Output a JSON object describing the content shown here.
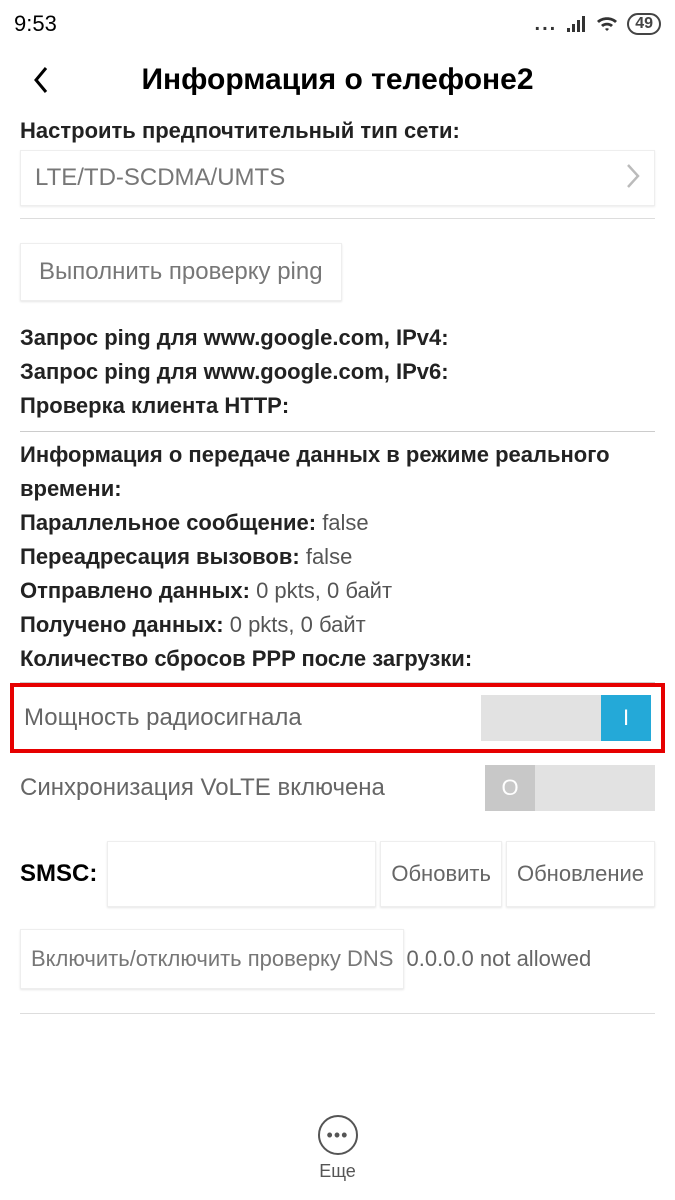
{
  "status": {
    "time": "9:53",
    "battery": "49"
  },
  "header": {
    "title": "Информация о телефоне2"
  },
  "network": {
    "label": "Настроить предпочтительный тип сети:",
    "value": "LTE/TD-SCDMA/UMTS"
  },
  "ping": {
    "button": "Выполнить проверку ping",
    "ipv4": "Запрос ping для www.google.com, IPv4:",
    "ipv6": "Запрос ping для www.google.com, IPv6:",
    "http": "Проверка клиента HTTP:"
  },
  "realtime": "Информация о передаче данных в режиме реального времени:",
  "stats": {
    "parallel_lbl": "Параллельное сообщение:",
    "parallel_val": " false",
    "forward_lbl": "Переадресация вызовов:",
    "forward_val": " false",
    "sent_lbl": "Отправлено данных:",
    "sent_val": " 0 pkts, 0 байт",
    "recv_lbl": "Получено данных:",
    "recv_val": " 0 pkts, 0 байт",
    "ppp_lbl": "Количество сбросов PPP после загрузки:"
  },
  "toggles": {
    "radio_lbl": "Мощность радиосигнала",
    "radio_on": "I",
    "volte_lbl": "Синхронизация VoLTE включена",
    "volte_off": "O"
  },
  "smsc": {
    "label": "SMSC:",
    "refresh": "Обновить",
    "update": "Обновление"
  },
  "dns": {
    "button": "Включить/отключить проверку DNS",
    "value": "0.0.0.0 not allowed"
  },
  "footer": {
    "more": "Еще"
  }
}
